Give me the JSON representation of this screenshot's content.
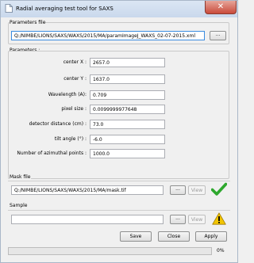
{
  "window": {
    "title": "Radial averaging test tool for SAXS",
    "close_glyph": "✕"
  },
  "parameters_file": {
    "label": "Parameters file",
    "path": "Q:/NIMBE/LIONS/SAXS/WAXS/2015/MA/paramImageJ_WAXS_02-07-2015.xml",
    "browse_label": "..."
  },
  "parameters": {
    "label": "Parameters :",
    "fields": [
      {
        "label": "center X :",
        "value": "2657.0"
      },
      {
        "label": "center Y :",
        "value": "1637.0"
      },
      {
        "label": "Wavelength (A):",
        "value": "0.709"
      },
      {
        "label": "pixel size :",
        "value": "0.0099999977648"
      },
      {
        "label": "detector distance (cm) :",
        "value": "73.0"
      },
      {
        "label": "tilt angle (°) :",
        "value": "-6.0"
      },
      {
        "label": "Number of azimuthal points :",
        "value": "1000.0"
      }
    ]
  },
  "mask_file": {
    "label": "Mask file",
    "path": "Q:/NIMBE/LIONS/SAXS/WAXS/2015/MA/mask.tif",
    "browse_label": "...",
    "view_label": "View",
    "status_icon": "checkmark-icon",
    "status_color": "#2ea82e"
  },
  "sample": {
    "label": "Sample",
    "path": "",
    "browse_label": "...",
    "view_label": "View",
    "status_icon": "warning-icon",
    "status_color": "#f2c500"
  },
  "buttons": {
    "save": "Save",
    "close": "Close",
    "apply": "Apply"
  },
  "progress": {
    "value": 0,
    "label": "0%"
  }
}
